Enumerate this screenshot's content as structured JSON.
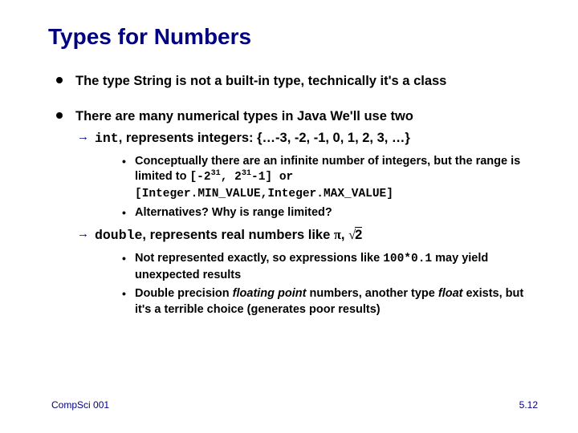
{
  "title": "Types for Numbers",
  "bullets": {
    "b1": "The type String is not a built-in type, technically it's a class",
    "b2": "There are many numerical types in Java  We'll use two",
    "int_type": "int",
    "int_rest": ", represents integers: {…-3, -2, -1, 0, 1, 2, 3, …}",
    "int_sub1_a": "Conceptually there are an infinite number of integers, but the range is limited to ",
    "int_sub1_code1a": "[-2",
    "int_sub1_exp1": "31",
    "int_sub1_code1b": ", 2",
    "int_sub1_exp2": "31",
    "int_sub1_code1c": "-1] or",
    "int_sub1_code2": "[Integer.MIN_VALUE,Integer.MAX_VALUE]",
    "int_sub2": "Alternatives? Why is range limited?",
    "double_type": "double",
    "double_rest_a": ", represents real numbers like  ",
    "double_pi": "π",
    "double_rest_b": ", ",
    "double_sqrt_sym": "√",
    "double_sqrt_arg": "2",
    "dbl_sub1_a": "Not represented exactly, so expressions like ",
    "dbl_sub1_code": "100*0.1",
    "dbl_sub1_b": " may yield unexpected results",
    "dbl_sub2_a": "Double precision ",
    "dbl_sub2_fp": "floating point",
    "dbl_sub2_b": " numbers, another type ",
    "dbl_sub2_float": "float",
    "dbl_sub2_c": " exists, but it's a terrible choice (generates poor results)"
  },
  "footer": {
    "left": "CompSci 001",
    "right": "5.12"
  }
}
